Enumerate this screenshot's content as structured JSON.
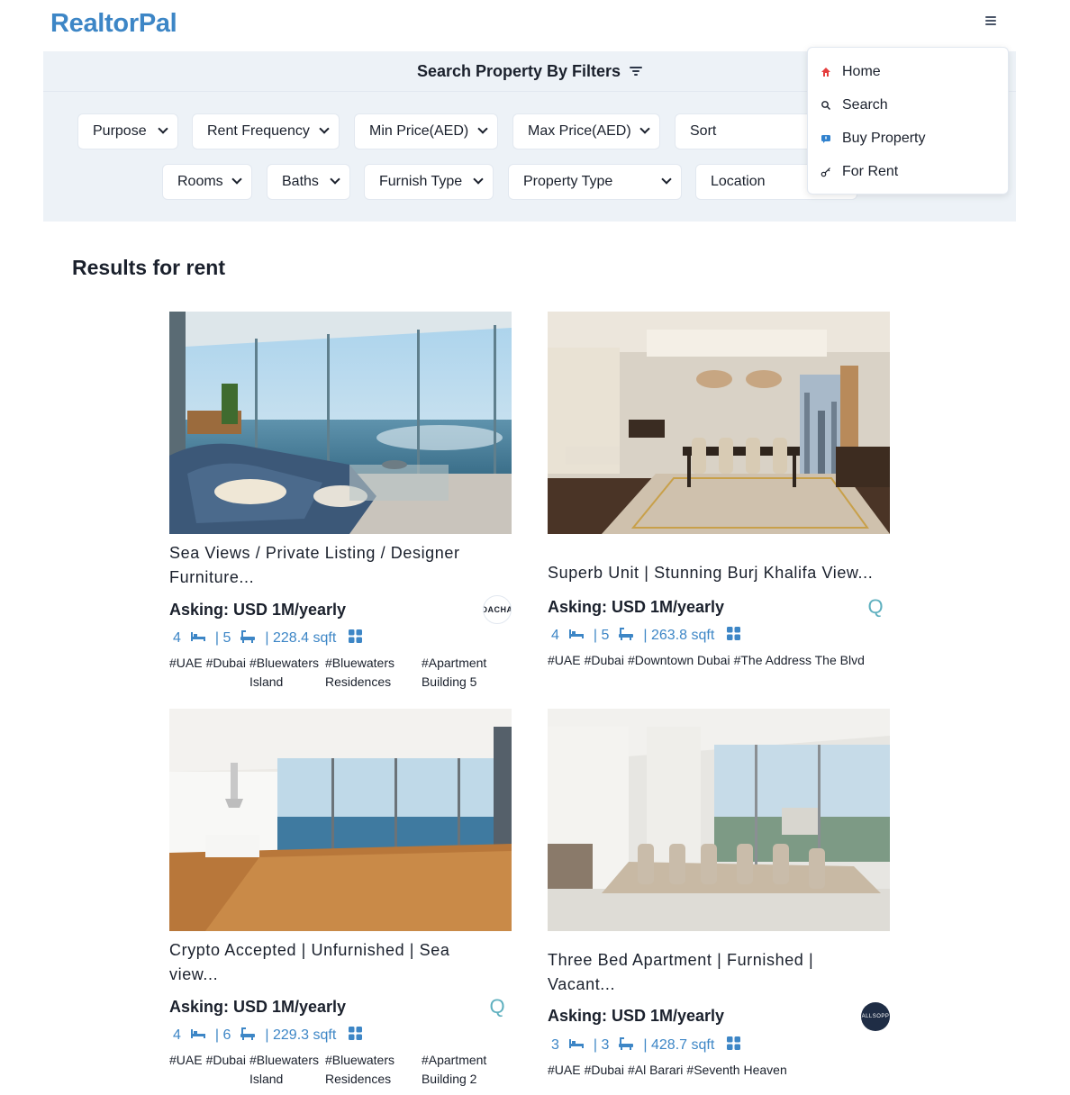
{
  "app": {
    "logo": "RealtorPal"
  },
  "filters": {
    "title": "Search Property By Filters",
    "row1": [
      "Purpose",
      "Rent Frequency",
      "Min Price(AED)",
      "Max Price(AED)",
      "Sort"
    ],
    "row2": [
      "Rooms",
      "Baths",
      "Furnish Type",
      "Property Type",
      "Location"
    ]
  },
  "menu": {
    "items": [
      {
        "label": "Home",
        "icon": "home-icon"
      },
      {
        "label": "Search",
        "icon": "search-icon"
      },
      {
        "label": "Buy Property",
        "icon": "buy-icon"
      },
      {
        "label": "For Rent",
        "icon": "key-icon"
      }
    ]
  },
  "results": {
    "title": "Results for rent",
    "cards": [
      {
        "title_line1": "Sea Views / Private Listing / Designer",
        "title_line2": "Furniture...",
        "asking": "Asking: USD 1M/yearly",
        "rooms": "4",
        "baths": "| 5",
        "area": "| 228.4 sqft",
        "tags": [
          "#UAE",
          "#Dubai",
          "#Bluewaters Island",
          "#Bluewaters Residences",
          "#Apartment Building 5"
        ],
        "agency_text": "DACHA"
      },
      {
        "title_line1": "Superb Unit | Stunning Burj Khalifa View...",
        "title_line2": "",
        "asking": "Asking: USD 1M/yearly",
        "rooms": "4",
        "baths": "| 5",
        "area": "| 263.8 sqft",
        "tags": [
          "#UAE",
          "#Dubai",
          "#Downtown Dubai",
          "#The Address The Blvd"
        ],
        "agency_text": "Q"
      },
      {
        "title_line1": "Crypto Accepted | Unfurnished | Sea",
        "title_line2": "view...",
        "asking": "Asking: USD 1M/yearly",
        "rooms": "4",
        "baths": "| 6",
        "area": "| 229.3 sqft",
        "tags": [
          "#UAE",
          "#Dubai",
          "#Bluewaters Island",
          "#Bluewaters Residences",
          "#Apartment Building 2"
        ],
        "agency_text": "Q"
      },
      {
        "title_line1": "Three Bed Apartment | Furnished |",
        "title_line2": "Vacant...",
        "asking": "Asking: USD 1M/yearly",
        "rooms": "3",
        "baths": "| 3",
        "area": "| 428.7 sqft",
        "tags": [
          "#UAE",
          "#Dubai",
          "#Al Barari",
          "#Seventh Heaven"
        ],
        "agency_text": "ALLSOPP"
      }
    ]
  },
  "colors": {
    "brand": "#3d86c6",
    "panel": "#edf2f7"
  }
}
